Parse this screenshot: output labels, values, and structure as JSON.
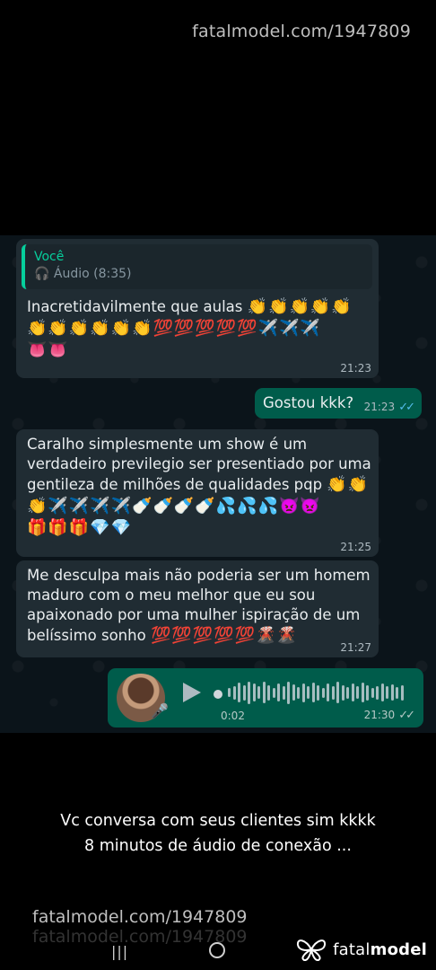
{
  "watermark_top": "fatalmodel.com/1947809",
  "messages": {
    "m1": {
      "reply_author": "Você",
      "reply_icon": "headphones-icon",
      "reply_text": "Áudio (8:35)",
      "text": "Inacretidavilmente que aulas",
      "emoji_line1": "👏👏👏👏👏",
      "emoji_line2": "👏👏👏👏👏👏💯💯💯💯💯✈️✈️✈️",
      "emoji_line3": "👅👅",
      "time": "21:23"
    },
    "m2": {
      "text": "Gostou kkk?",
      "time": "21:23",
      "ticks": "✓✓"
    },
    "m3": {
      "line1": "Caralho simplesmente um show é um",
      "line2": "verdadeiro previlegio ser presentiado por uma",
      "line3": "gentileza de milhões de qualidades pqp",
      "emoji_end3": "👏👏",
      "emoji_line4": "👏✈️✈️✈️✈️🍼🍼🍼🍼💦💦💦👿👿",
      "emoji_line5": "🎁🎁🎁💎💎",
      "time": "21:25"
    },
    "m4": {
      "line1": "Me desculpa mais não poderia ser um homem",
      "line2": "maduro com o meu melhor que eu sou",
      "line3": "apaixonado por uma mulher ispiração de um",
      "line4": "belíssimo sonho",
      "emoji_end4": "💯💯💯💯💯🌋🌋",
      "time": "21:27"
    },
    "voice": {
      "duration": "0:02",
      "time": "21:30",
      "ticks": "✓✓",
      "mic_icon": "microphone-icon",
      "play_icon": "play-icon",
      "waveform": [
        0.35,
        0.55,
        0.8,
        0.6,
        0.9,
        0.7,
        0.5,
        0.85,
        0.6,
        0.4,
        0.7,
        0.55,
        0.9,
        0.65,
        0.45,
        0.75,
        0.5,
        0.8,
        0.6,
        0.4,
        0.7,
        0.55,
        0.85,
        0.6,
        0.45,
        0.7,
        0.5,
        0.8,
        0.6,
        0.4,
        0.55,
        0.7,
        0.5,
        0.65,
        0.45,
        0.6
      ]
    }
  },
  "caption": {
    "line1": "Vc conversa com seus clientes sim kkkk",
    "line2": "8 minutos de áudio de conexão ..."
  },
  "watermark_bottom": "fatalmodel.com/1947809",
  "watermark_ghost": "fatalmodel.com/1947809",
  "nav": {
    "recent": "|||",
    "home_icon": "home-circle-icon"
  },
  "logo": {
    "word_light": "fatal",
    "word_bold": "model"
  },
  "colors": {
    "chat_bg": "#0b141a",
    "incoming": "#202c33",
    "outgoing": "#005c4b",
    "accent": "#06cf9c",
    "ticks": "#53bdeb"
  }
}
